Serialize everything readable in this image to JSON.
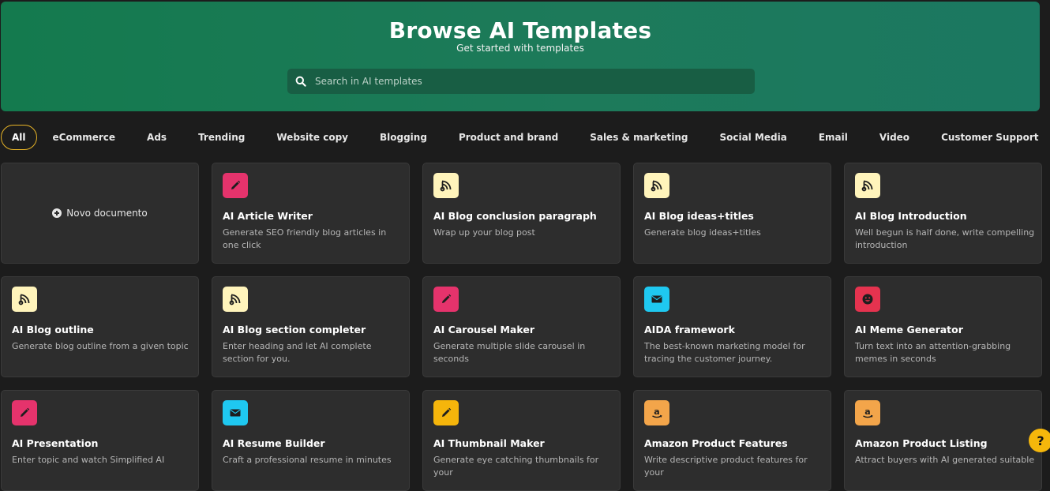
{
  "hero": {
    "title": "Browse AI Templates",
    "subtitle": "Get started with templates",
    "search_placeholder": "Search in AI templates"
  },
  "tabs": [
    {
      "label": "All",
      "active": true
    },
    {
      "label": "eCommerce"
    },
    {
      "label": "Ads"
    },
    {
      "label": "Trending"
    },
    {
      "label": "Website copy"
    },
    {
      "label": "Blogging"
    },
    {
      "label": "Product and brand"
    },
    {
      "label": "Sales & marketing"
    },
    {
      "label": "Social Media"
    },
    {
      "label": "Email"
    },
    {
      "label": "Video"
    },
    {
      "label": "Customer Support"
    }
  ],
  "new_document_label": "Novo documento",
  "cards": [
    {
      "title": "AI Article Writer",
      "desc": "Generate SEO friendly blog articles in one click",
      "icon": "pencil-icon",
      "color": "#e5336c"
    },
    {
      "title": "AI Blog conclusion paragraph",
      "desc": "Wrap up your blog post",
      "icon": "blog-icon",
      "color": "#fff4bb"
    },
    {
      "title": "AI Blog ideas+titles",
      "desc": "Generate blog ideas+titles",
      "icon": "blog-icon",
      "color": "#fff4bb"
    },
    {
      "title": "AI Blog Introduction",
      "desc": "Well begun is half done, write compelling introduction",
      "icon": "blog-icon",
      "color": "#fff4bb"
    },
    {
      "title": "AI Blog outline",
      "desc": "Generate blog outline from a given topic",
      "icon": "blog-icon",
      "color": "#fff4bb"
    },
    {
      "title": "AI Blog section completer",
      "desc": "Enter heading and let AI complete section for you.",
      "icon": "blog-icon",
      "color": "#fff4bb"
    },
    {
      "title": "AI Carousel Maker",
      "desc": "Generate multiple slide carousel in seconds",
      "icon": "pencil-icon",
      "color": "#e5336c"
    },
    {
      "title": "AIDA framework",
      "desc": "The best-known marketing model for tracing the customer journey.",
      "icon": "envelope-icon",
      "color": "#1fc8f0"
    },
    {
      "title": "AI Meme Generator",
      "desc": "Turn text into an attention-grabbing memes in seconds",
      "icon": "smiley-icon",
      "color": "#e5334f"
    },
    {
      "title": "AI Presentation",
      "desc": "Enter topic and watch Simplified AI",
      "icon": "pencil-icon",
      "color": "#e5336c"
    },
    {
      "title": "AI Resume Builder",
      "desc": "Craft a professional resume in minutes",
      "icon": "envelope-icon",
      "color": "#1fc8f0"
    },
    {
      "title": "AI Thumbnail Maker",
      "desc": "Generate eye catching thumbnails for your",
      "icon": "pencil-icon",
      "color": "#f5b50b"
    },
    {
      "title": "Amazon Product Features",
      "desc": "Write descriptive product features for your",
      "icon": "amazon-icon",
      "color": "#f3a54a"
    },
    {
      "title": "Amazon Product Listing",
      "desc": "Attract buyers with AI generated suitable",
      "icon": "amazon-icon",
      "color": "#f3a54a"
    }
  ],
  "help_label": "?"
}
